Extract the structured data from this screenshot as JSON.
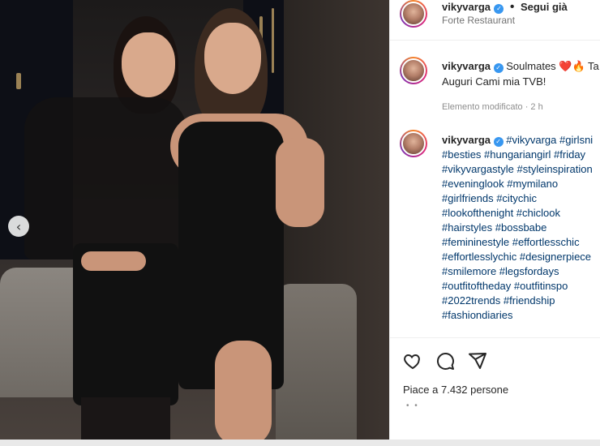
{
  "post_header": {
    "username": "vikyvarga",
    "separator": "•",
    "follow_label": "Segui già",
    "location": "Forte Restaurant"
  },
  "caption": {
    "username": "vikyvarga",
    "text": "Soulmates ❤️🔥 Ta",
    "text2": "Auguri Cami mia TVB!",
    "meta": "Elemento modificato · 2 h"
  },
  "comment": {
    "username": "vikyvarga",
    "lines": [
      "#vikyvarga #girlsni",
      "#besties #hungariangirl #friday",
      "#vikyvargastyle #styleinspiration",
      "#eveninglook #mymilano",
      "#girlfriends #citychic",
      "#lookofthenight #chiclook",
      "#hairstyles #bossbabe",
      "#femininestyle #effortlesschic",
      "#effortlesslychic #designerpiece",
      "#smilemore #legsfordays",
      "#outfitoftheday #outfitinspo",
      "#2022trends #friendship",
      "#fashiondiaries"
    ]
  },
  "actions": {
    "likes_text": "Piace a 7.432 persone",
    "more_dots": "• •"
  },
  "icons": {
    "prev": "chevron-left-icon",
    "like": "heart-icon",
    "comment": "comment-icon",
    "share": "share-icon",
    "verified": "verified-badge-icon"
  },
  "colors": {
    "verified": "#3897f0",
    "hashtag": "#00376b",
    "heart": "#ed4956"
  }
}
